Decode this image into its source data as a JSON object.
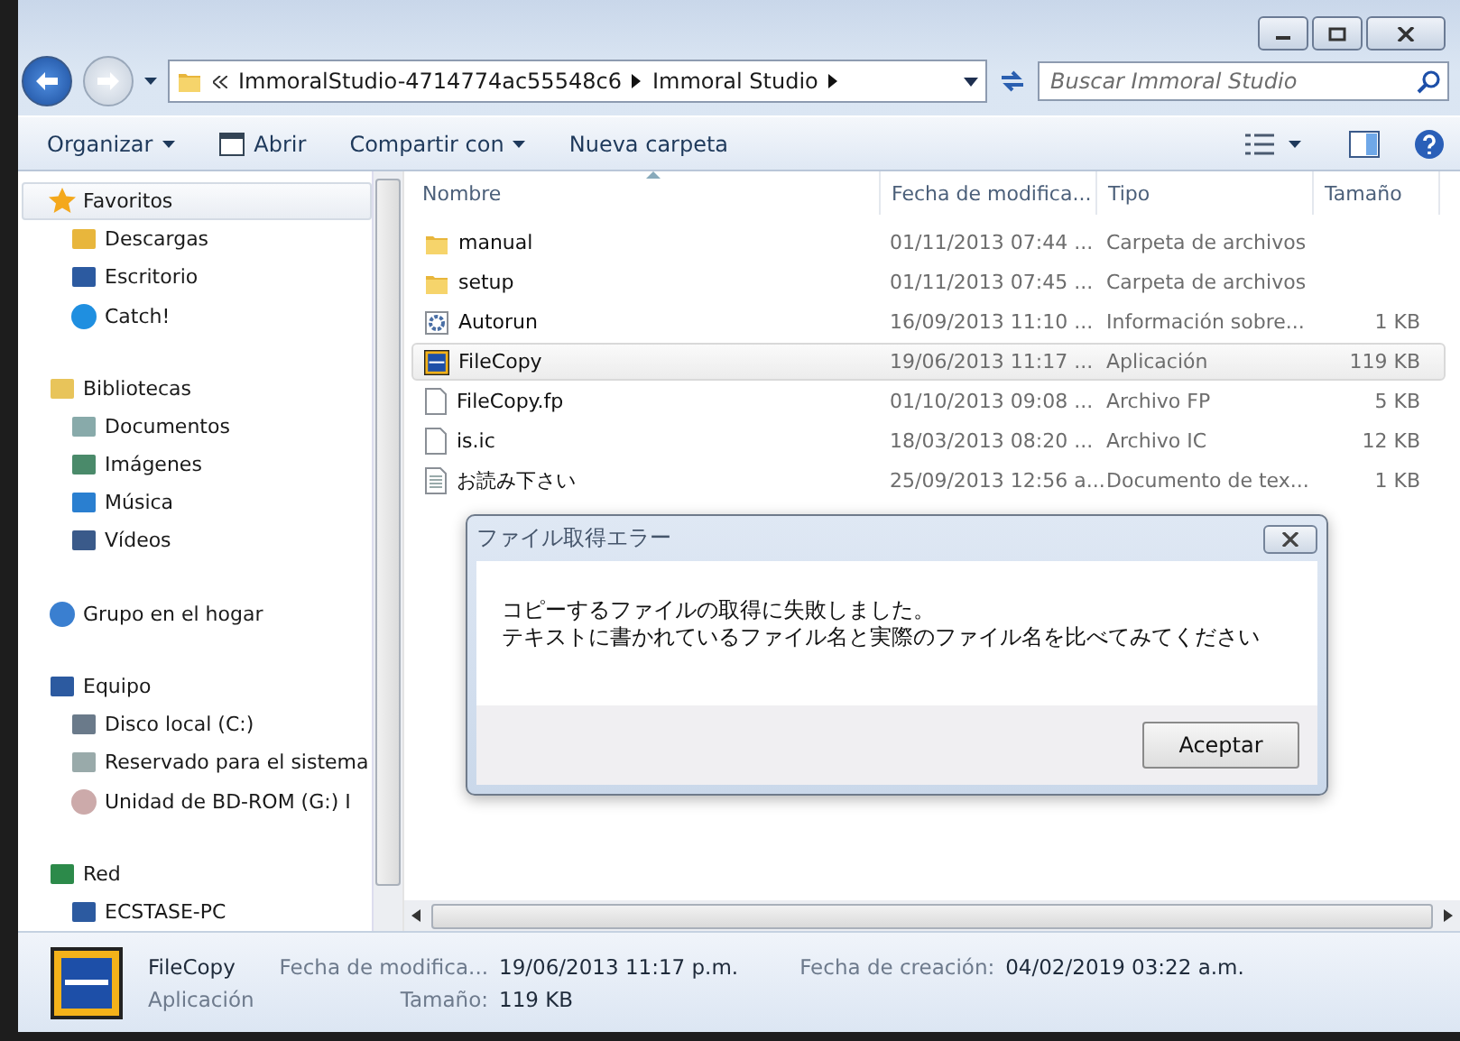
{
  "address": {
    "segments": [
      "ImmoralStudio-4714774ac55548c6",
      "Immoral Studio"
    ],
    "search_placeholder": "Buscar Immoral Studio"
  },
  "toolbar": {
    "items": [
      {
        "label": "Organizar",
        "dropdown": true
      },
      {
        "label": "Abrir",
        "dropdown": false
      },
      {
        "label": "Compartir con",
        "dropdown": true
      },
      {
        "label": "Nueva carpeta",
        "dropdown": false
      }
    ]
  },
  "sidebar": {
    "groups": [
      {
        "label": "Favoritos",
        "selected": true,
        "children": [
          {
            "label": "Descargas"
          },
          {
            "label": "Escritorio"
          },
          {
            "label": "Catch!"
          }
        ]
      },
      {
        "label": "Bibliotecas",
        "selected": false,
        "children": [
          {
            "label": "Documentos"
          },
          {
            "label": "Imágenes"
          },
          {
            "label": "Música"
          },
          {
            "label": "Vídeos"
          }
        ]
      },
      {
        "label": "Grupo en el hogar",
        "selected": false
      },
      {
        "label": "Equipo",
        "selected": false,
        "children": [
          {
            "label": "Disco local (C:)"
          },
          {
            "label": "Reservado para el sistema"
          },
          {
            "label": "Unidad de BD-ROM (G:) I"
          }
        ]
      },
      {
        "label": "Red",
        "selected": false,
        "children": [
          {
            "label": "ECSTASE-PC"
          }
        ]
      }
    ]
  },
  "table": {
    "columns": [
      {
        "label": "Nombre",
        "sorted": true
      },
      {
        "label": "Fecha de modifica...",
        "sorted": false
      },
      {
        "label": "Tipo",
        "sorted": false
      },
      {
        "label": "Tamaño",
        "sorted": false
      }
    ],
    "rows": [
      {
        "kind": "folder",
        "name": "manual",
        "date": "01/11/2013 07:44 ...",
        "type": "Carpeta de archivos",
        "size": "",
        "selected": false
      },
      {
        "kind": "folder",
        "name": "setup",
        "date": "01/11/2013 07:45 ...",
        "type": "Carpeta de archivos",
        "size": "",
        "selected": false
      },
      {
        "kind": "settings",
        "name": "Autorun",
        "date": "16/09/2013 11:10 ...",
        "type": "Información sobre...",
        "size": "1 KB",
        "selected": false
      },
      {
        "kind": "app",
        "name": "FileCopy",
        "date": "19/06/2013 11:17 ...",
        "type": "Aplicación",
        "size": "119 KB",
        "selected": true
      },
      {
        "kind": "file",
        "name": "FileCopy.fp",
        "date": "01/10/2013 09:08 ...",
        "type": "Archivo FP",
        "size": "5 KB",
        "selected": false
      },
      {
        "kind": "file",
        "name": "is.ic",
        "date": "18/03/2013 08:20 ...",
        "type": "Archivo IC",
        "size": "12 KB",
        "selected": false
      },
      {
        "kind": "text",
        "name": "お読み下さい",
        "date": "25/09/2013 12:56 a...",
        "type": "Documento de tex...",
        "size": "1 KB",
        "selected": false
      }
    ]
  },
  "dialog": {
    "title": "ファイル取得エラー",
    "message": [
      "コピーするファイルの取得に失敗しました。",
      "テキストに書かれているファイル名と実際のファイル名を比べてみてください"
    ],
    "button": "Aceptar"
  },
  "details": {
    "name": "FileCopy",
    "type": "Aplicación",
    "fields": [
      {
        "label": "Fecha de modifica...",
        "value": "19/06/2013 11:17 p.m."
      },
      {
        "label": "Tamaño:",
        "value": "119 KB"
      },
      {
        "label": "Fecha de creación:",
        "value": "04/02/2019 03:22 a.m."
      }
    ]
  }
}
